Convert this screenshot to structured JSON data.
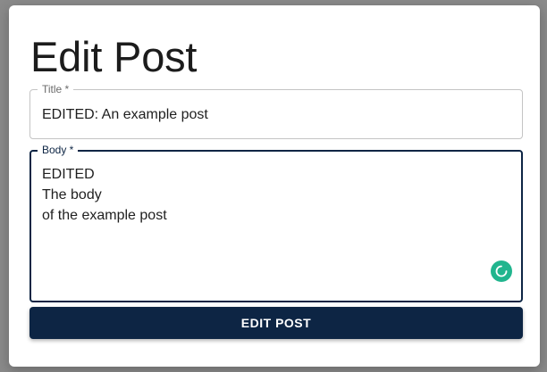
{
  "page": {
    "heading": "Edit Post"
  },
  "form": {
    "title_field": {
      "label": "Title *",
      "value": "EDITED: An example post"
    },
    "body_field": {
      "label": "Body *",
      "value": "EDITED\nThe body\nof the example post"
    },
    "submit_label": "EDIT POST"
  },
  "icons": {
    "grammar_assistant": "spinner-icon"
  },
  "colors": {
    "primary": "#0d2544",
    "assistant_badge": "#21b58e",
    "backdrop": "#8a8a8a"
  }
}
